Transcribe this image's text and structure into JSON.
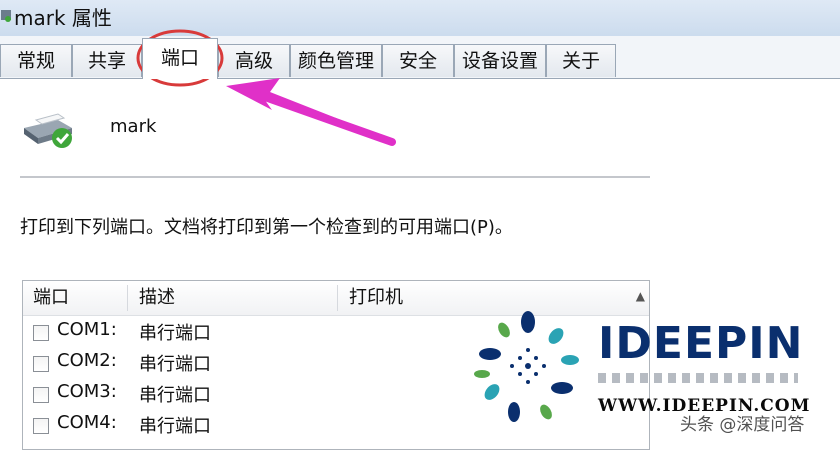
{
  "window": {
    "title": "mark 属性"
  },
  "tabs": [
    {
      "label": "常规"
    },
    {
      "label": "共享"
    },
    {
      "label": "端口",
      "active": true
    },
    {
      "label": "高级"
    },
    {
      "label": "颜色管理"
    },
    {
      "label": "安全"
    },
    {
      "label": "设备设置"
    },
    {
      "label": "关于"
    }
  ],
  "printer": {
    "name": "mark",
    "icon": "printer-icon"
  },
  "ports_page": {
    "description": "打印到下列端口。文档将打印到第一个检查到的可用端口(P)。",
    "columns": [
      "端口",
      "描述",
      "打印机"
    ],
    "rows": [
      {
        "port": "COM1:",
        "type": "串行端口",
        "checked": false
      },
      {
        "port": "COM2:",
        "type": "串行端口",
        "checked": false
      },
      {
        "port": "COM3:",
        "type": "串行端口",
        "checked": false
      },
      {
        "port": "COM4:",
        "type": "串行端口",
        "checked": false
      }
    ]
  },
  "watermark": {
    "logo_text": "IDEEPIN",
    "url": "WWW.IDEEPIN.COM",
    "source": "头条 @深度问答"
  },
  "colors": {
    "annotation": "#e030c8",
    "highlight_circle": "#d83a3a",
    "logo_blue": "#0a2f6e",
    "logo_teal": "#2aa3b4",
    "logo_green": "#58a84b"
  }
}
